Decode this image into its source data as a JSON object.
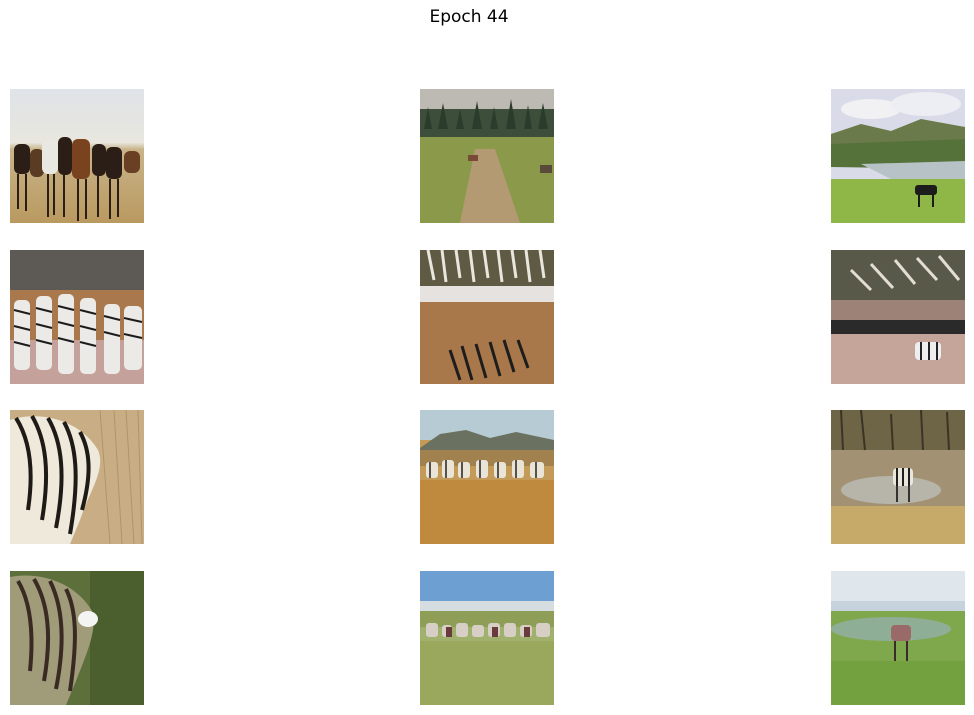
{
  "figure": {
    "title": "Epoch 44"
  },
  "images": [
    {
      "row": 1,
      "col": 1,
      "subject": "horse-herd"
    },
    {
      "row": 1,
      "col": 2,
      "subject": "dirt-path-field"
    },
    {
      "row": 1,
      "col": 3,
      "subject": "river-valley-horse"
    },
    {
      "row": 2,
      "col": 1,
      "subject": "generated-zebra-herd"
    },
    {
      "row": 2,
      "col": 2,
      "subject": "generated-zebra-path"
    },
    {
      "row": 2,
      "col": 3,
      "subject": "generated-zebra-valley"
    },
    {
      "row": 3,
      "col": 1,
      "subject": "zebra-grazing"
    },
    {
      "row": 3,
      "col": 2,
      "subject": "zebra-herd-savanna"
    },
    {
      "row": 3,
      "col": 3,
      "subject": "lone-zebra"
    },
    {
      "row": 4,
      "col": 1,
      "subject": "generated-horse-grazing"
    },
    {
      "row": 4,
      "col": 2,
      "subject": "generated-horse-herd"
    },
    {
      "row": 4,
      "col": 3,
      "subject": "generated-lone-horse"
    }
  ]
}
